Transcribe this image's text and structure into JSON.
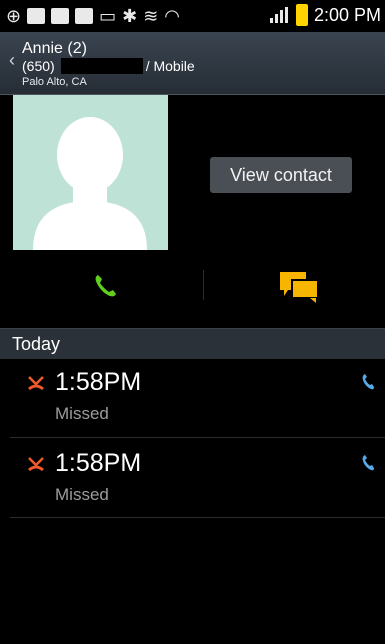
{
  "status_bar": {
    "time": "2:00 PM"
  },
  "contact": {
    "name": "Annie (2)",
    "phone_prefix": "(650)",
    "phone_type": "/ Mobile",
    "location": "Palo Alto, CA"
  },
  "actions": {
    "view_contact": "View contact"
  },
  "section": {
    "title": "Today"
  },
  "call_log": [
    {
      "time": "1:58PM",
      "status": "Missed"
    },
    {
      "time": "1:58PM",
      "status": "Missed"
    }
  ],
  "colors": {
    "call_green": "#5fce1f",
    "message_yellow": "#f7b500",
    "missed_orange": "#f05a28",
    "header_bg": "#2e3640",
    "accent_blue": "#59a9e6"
  },
  "icons": {
    "back": "chevron-left-icon",
    "call": "phone-icon",
    "message": "chat-bubbles-icon",
    "missed": "missed-call-icon",
    "call_back": "phone-small-icon"
  }
}
